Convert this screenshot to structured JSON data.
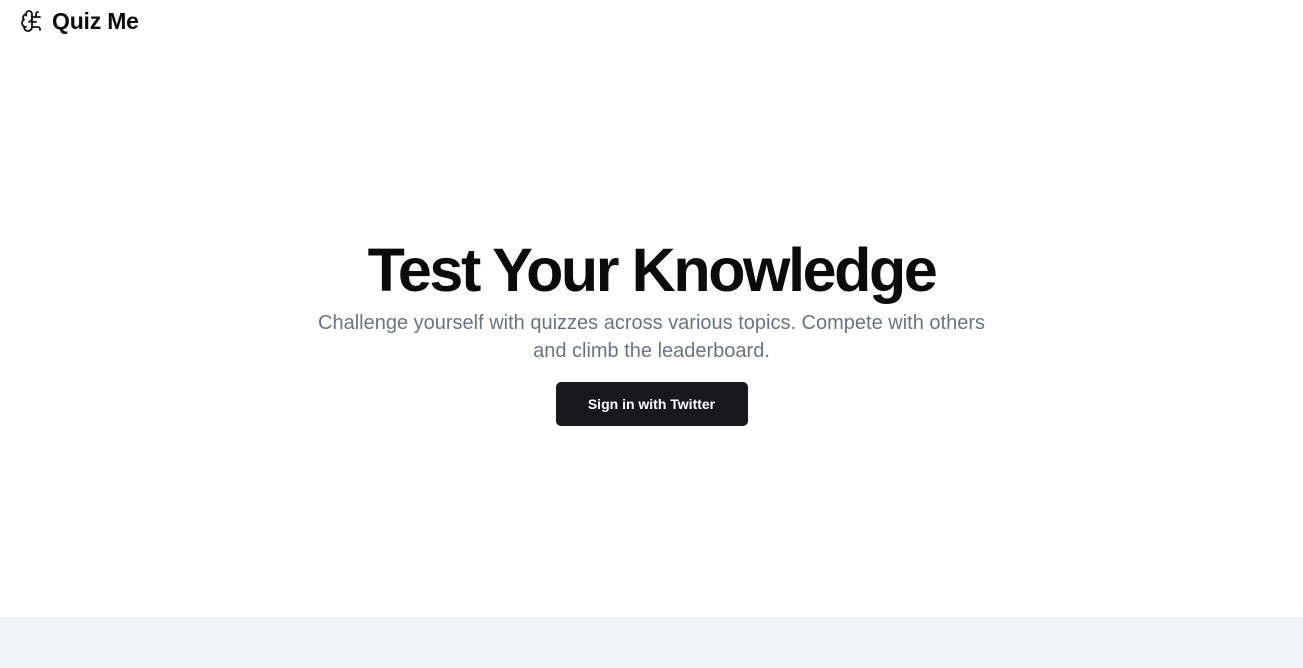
{
  "header": {
    "logo_icon": "brain-icon",
    "brand": "Quiz Me"
  },
  "hero": {
    "title": "Test Your Knowledge",
    "subtitle": "Challenge yourself with quizzes across various topics. Compete with others and climb the leaderboard.",
    "cta_label": "Sign in with Twitter"
  },
  "colors": {
    "text_primary": "#0b0b0b",
    "text_muted": "#6b7280",
    "button_bg": "#18181b",
    "button_text": "#ffffff",
    "footer_bg": "#f3f4f6"
  }
}
